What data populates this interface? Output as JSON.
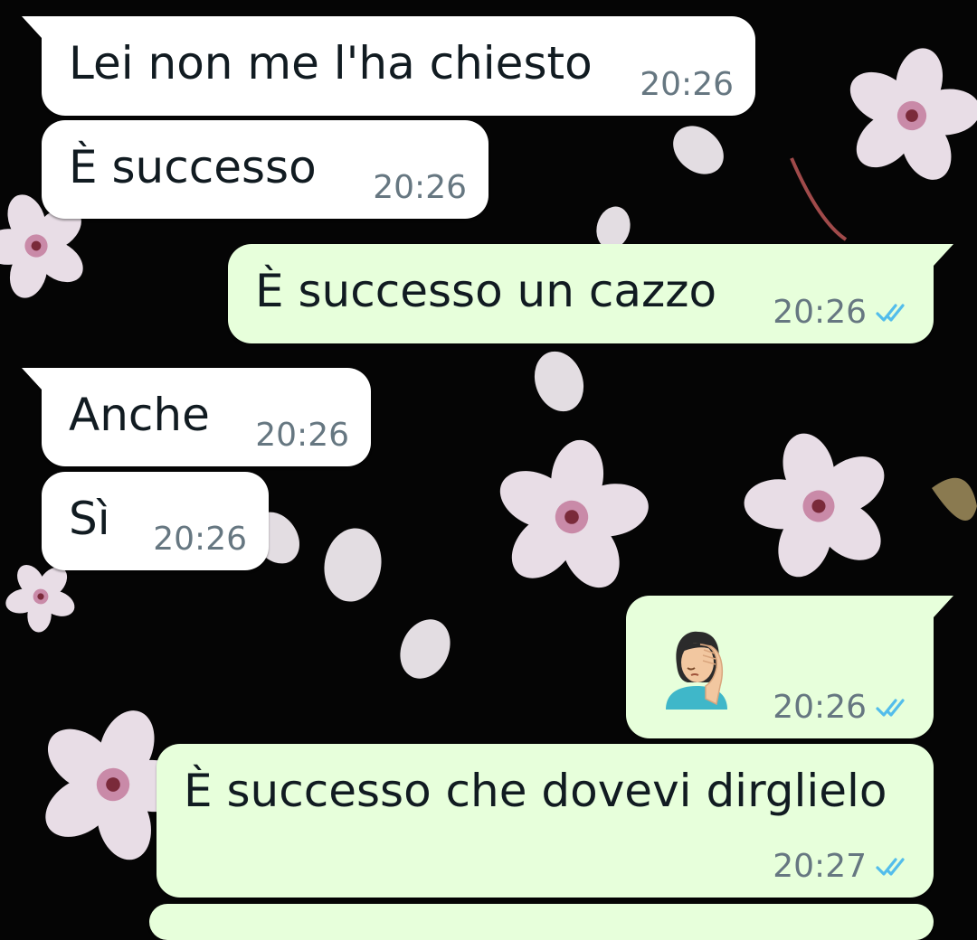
{
  "theme": {
    "incoming_bubble": "#ffffff",
    "outgoing_bubble": "#e7ffdb",
    "timestamp_color": "#667781",
    "read_tick_color": "#53bdeb",
    "wallpaper_background": "#050505",
    "wallpaper_motif": "cherry-blossom-flowers"
  },
  "messages": [
    {
      "direction": "incoming",
      "text": "Lei non me l'ha chiesto",
      "time": "20:26"
    },
    {
      "direction": "incoming",
      "text": "È successo",
      "time": "20:26"
    },
    {
      "direction": "outgoing",
      "text": "È successo un cazzo",
      "time": "20:26",
      "status_icon": "double-check-read-icon"
    },
    {
      "direction": "incoming",
      "text": "Anche",
      "time": "20:26"
    },
    {
      "direction": "incoming",
      "text": "Sì",
      "time": "20:26"
    },
    {
      "direction": "outgoing",
      "emoji": "woman-facepalming-emoji",
      "time": "20:26",
      "status_icon": "double-check-read-icon"
    },
    {
      "direction": "outgoing",
      "text": "È successo che dovevi dirglielo",
      "time": "20:27",
      "status_icon": "double-check-read-icon"
    }
  ]
}
